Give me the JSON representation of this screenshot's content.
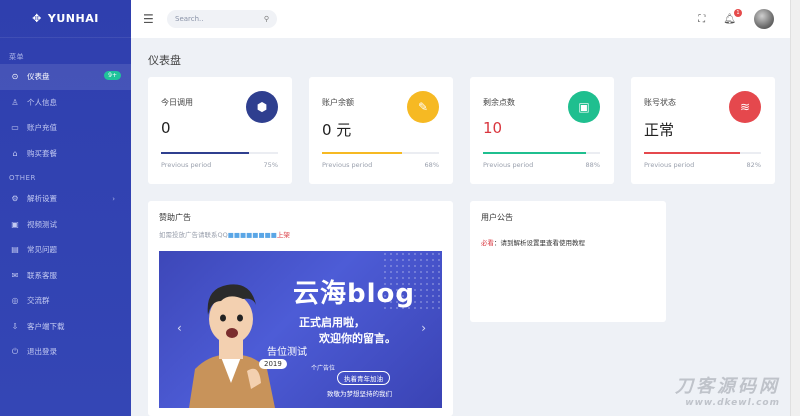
{
  "brand": {
    "name": "YUNHAI",
    "logo_icon": "✥"
  },
  "sidebar": {
    "section_menu": "菜单",
    "section_other": "OTHER",
    "items": [
      {
        "label": "仪表盘",
        "icon": "⊙",
        "badge": "9+",
        "active": true
      },
      {
        "label": "个人信息",
        "icon": "♙"
      },
      {
        "label": "账户充值",
        "icon": "▭"
      },
      {
        "label": "购买套餐",
        "icon": "⌂"
      }
    ],
    "other_items": [
      {
        "label": "解析设置",
        "icon": "⚙",
        "chevron": "›"
      },
      {
        "label": "视频测试",
        "icon": "▣"
      },
      {
        "label": "常见问题",
        "icon": "▤"
      },
      {
        "label": "联系客服",
        "icon": "✉"
      },
      {
        "label": "交流群",
        "icon": "◎"
      },
      {
        "label": "客户端下载",
        "icon": "⇩"
      },
      {
        "label": "退出登录",
        "icon": "⏻"
      }
    ]
  },
  "topbar": {
    "search_placeholder": "Search..",
    "notif_count": "1"
  },
  "page": {
    "title": "仪表盘"
  },
  "cards": [
    {
      "label": "今日调用",
      "value": "0",
      "period": "Previous period",
      "pct": "75%",
      "fill": 0.75,
      "color": "#2f3f8f",
      "icon": "⬢"
    },
    {
      "label": "账户余额",
      "value": "0 元",
      "period": "Previous period",
      "pct": "68%",
      "fill": 0.68,
      "color": "#f6b923",
      "icon": "✎"
    },
    {
      "label": "剩余点数",
      "value": "10",
      "period": "Previous period",
      "pct": "88%",
      "fill": 0.88,
      "color": "#1fbf8f",
      "icon": "▣"
    },
    {
      "label": "账号状态",
      "value": "正常",
      "period": "Previous period",
      "pct": "82%",
      "fill": 0.82,
      "color": "#e5484d",
      "icon": "≋"
    }
  ],
  "ad_panel": {
    "title": "赞助广告",
    "sub_prefix": "如需投放广告请联系QQ",
    "sub_qq": "■■■■■■■■",
    "sub_suffix": "上架"
  },
  "banner": {
    "headline": "云海blog",
    "line2": "正式启用啦，",
    "line3": "欢迎你的留言。",
    "tag1": "告位测试",
    "tag2": "个广告位",
    "year": "2019",
    "chip": "执着青年加油",
    "foot": "致敬为梦想坚持的我们"
  },
  "notice_panel": {
    "title": "用户公告",
    "must": "必看",
    "text": "：请到解析设置里查看使用教程"
  },
  "watermark": {
    "line1": "刀客源码网",
    "line2": "www.dkewl.com"
  }
}
